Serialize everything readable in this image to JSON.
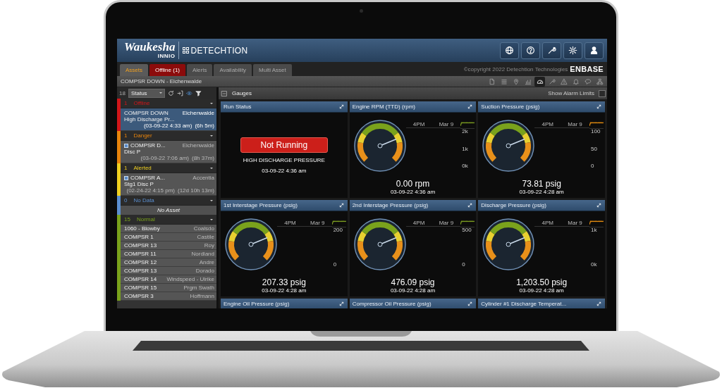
{
  "header": {
    "brand": "Waukesha",
    "brand_sub": "INNIO",
    "product": "DETECHTION",
    "buttons": [
      {
        "kind": "globe"
      },
      {
        "kind": "help"
      },
      {
        "kind": "wrench"
      },
      {
        "kind": "settings"
      },
      {
        "kind": "user"
      }
    ]
  },
  "tabs": [
    {
      "label": "Assets",
      "kind": "normal",
      "selected": true
    },
    {
      "label": "Offline (1)",
      "kind": "alarm",
      "selected": false
    },
    {
      "label": "Alerts",
      "kind": "normal",
      "selected": false
    },
    {
      "label": "Availability",
      "kind": "normal",
      "selected": false
    },
    {
      "label": "Multi Asset",
      "kind": "normal",
      "selected": false
    }
  ],
  "copyright": "©copyright 2022 Detechtion Technologies",
  "enbase": "ENBASE",
  "breadcrumb": "COMPSR DOWN - Eichenwalde",
  "view_icons": [
    {
      "kind": "document",
      "selected": false
    },
    {
      "kind": "list",
      "selected": false
    },
    {
      "kind": "pin",
      "selected": false
    },
    {
      "kind": "chart",
      "selected": false
    },
    {
      "kind": "gauge",
      "selected": true
    },
    {
      "kind": "wrench",
      "selected": false
    },
    {
      "kind": "warning",
      "selected": false
    },
    {
      "kind": "bell",
      "selected": false
    },
    {
      "kind": "chat",
      "selected": false
    },
    {
      "kind": "org",
      "selected": false
    }
  ],
  "sidebar": {
    "count": "18",
    "sort": "Status",
    "groups": [
      {
        "count": "1",
        "label": "Offline",
        "color": "#d0161a",
        "items": [
          {
            "name": "COMPSR DOWN",
            "site": "Eichenwalde",
            "detail": "High Discharge Pr...",
            "time": "(03-09-22 4:33 am)",
            "duration": "(6h 5m)",
            "flagged": false,
            "selected": true
          }
        ]
      },
      {
        "count": "1",
        "label": "Danger",
        "color": "#e8840c",
        "items": [
          {
            "name": "COMPSR D...",
            "site": "Eichenwalde",
            "detail": "Disc P",
            "time": "(03-09-22 7:06 am)",
            "duration": "(8h 37m)",
            "flagged": true,
            "selected": false
          }
        ]
      },
      {
        "count": "1",
        "label": "Alerted",
        "color": "#f0d020",
        "items": [
          {
            "name": "COMPSR A...",
            "site": "Accentia",
            "detail": "Stg1 Disc P",
            "time": "(02-24-22 4:15 pm)",
            "duration": "(12d 10h 13m)",
            "flagged": true,
            "selected": false
          }
        ]
      },
      {
        "count": "0",
        "label": "No Data",
        "color": "#5b8fd0",
        "empty_text": "No Asset"
      },
      {
        "count": "15",
        "label": "Normal",
        "color": "#7aa21c",
        "items": [
          {
            "name": "1060 - Blowby",
            "site": "Coalsdo",
            "selected": false
          },
          {
            "name": "COMPSR 1",
            "site": "Castile",
            "selected": false
          },
          {
            "name": "COMPSR 13",
            "site": "Roy",
            "selected": false
          },
          {
            "name": "COMPSR 11",
            "site": "Nordland",
            "selected": false
          },
          {
            "name": "COMPSR 12",
            "site": "Andre",
            "selected": false
          },
          {
            "name": "COMPSR 13",
            "site": "Dorado",
            "selected": false
          },
          {
            "name": "COMPSR 14",
            "site": "Windspeed - Ulrike",
            "selected": false
          },
          {
            "name": "COMPSR 15",
            "site": "Prgm Swath",
            "selected": false
          },
          {
            "name": "COMPSR 3",
            "site": "Hoffmann",
            "selected": false
          }
        ]
      }
    ]
  },
  "gauges": {
    "title": "Gauges",
    "alarm_limits_label": "Show Alarm Limits",
    "alarm_limits_checked": false,
    "cards": [
      {
        "kind": "status",
        "title": "Run Status",
        "status": "Not Running",
        "reason": "HIGH DISCHARGE PRESSURE",
        "time": "03-09-22 4:36 am"
      },
      {
        "kind": "gauge",
        "title": "Engine RPM (TTD) (rpm)",
        "color": "#7a9a20",
        "x_labels": [
          "4PM",
          "Mar 9"
        ],
        "y_labels": [
          "2k",
          "1k",
          "0k"
        ],
        "value": "0.00 rpm",
        "time": "03-09-22 4:36 am"
      },
      {
        "kind": "gauge",
        "title": "Suction Pressure (psig)",
        "color": "#e08a10",
        "x_labels": [
          "4PM",
          "Mar 9"
        ],
        "y_labels": [
          "100",
          "50",
          "0"
        ],
        "value": "73.81 psig",
        "time": "03-09-22 4:28 am"
      },
      {
        "kind": "gauge",
        "title": "1st Interstage Pressure (psig)",
        "color": "#7a9a20",
        "x_labels": [
          "4PM",
          "Mar 9"
        ],
        "y_labels": [
          "200",
          "0"
        ],
        "value": "207.33 psig",
        "time": "03-09-22 4:28 am"
      },
      {
        "kind": "gauge",
        "title": "2nd Interstage Pressure (psig)",
        "color": "#7a9a20",
        "x_labels": [
          "4PM",
          "Mar 9"
        ],
        "y_labels": [
          "500",
          "0"
        ],
        "value": "476.09 psig",
        "time": "03-09-22 4:28 am"
      },
      {
        "kind": "gauge",
        "title": "Discharge Pressure (psig)",
        "color": "#e08a10",
        "x_labels": [
          "4PM",
          "Mar 9"
        ],
        "y_labels": [
          "1k",
          "0k"
        ],
        "value": "1,203.50 psig",
        "time": "03-09-22 4:28 am"
      },
      {
        "kind": "cut",
        "title": "Engine Oil Pressure (psig)"
      },
      {
        "kind": "cut",
        "title": "Compressor Oil Pressure (psig)"
      },
      {
        "kind": "cut",
        "title": "Cylinder #1 Discharge Temperat..."
      }
    ]
  }
}
